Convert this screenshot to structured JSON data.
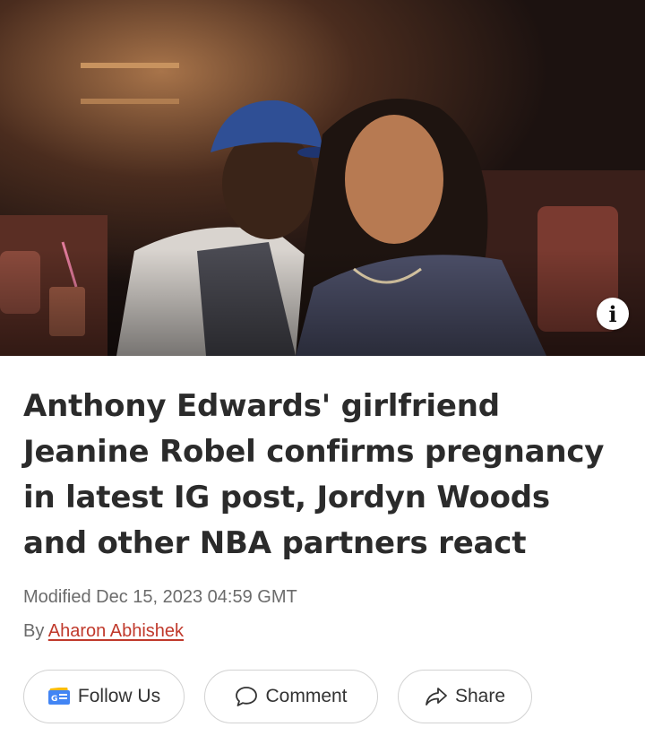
{
  "article": {
    "headline": "Anthony Edwards' girlfriend Jeanine Robel confirms pregnancy in latest IG post, Jordyn Woods and other NBA partners react",
    "modified": "Modified Dec 15, 2023 04:59 GMT",
    "by_prefix": "By",
    "author": "Aharon Abhishek"
  },
  "hero": {
    "info_icon_glyph": "i"
  },
  "actions": {
    "follow_label": "Follow Us",
    "comment_label": "Comment",
    "share_label": "Share"
  },
  "colors": {
    "headline": "#2b2b2b",
    "meta": "#6b6b6b",
    "author_link": "#c0392b",
    "pill_border": "#d2d2d2"
  },
  "icons": {
    "follow": "google-news-icon",
    "comment": "comment-bubble-icon",
    "share": "share-arrow-icon",
    "info": "info-icon"
  }
}
